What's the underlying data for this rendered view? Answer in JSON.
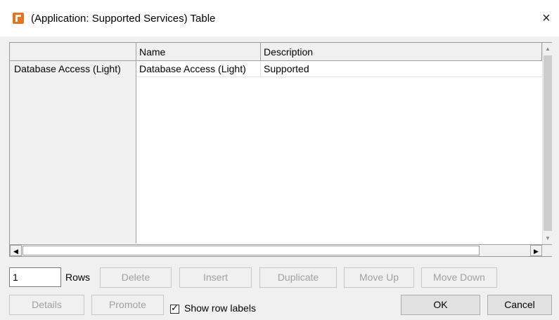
{
  "window": {
    "title": "(Application: Supported Services) Table",
    "close_symbol": "×"
  },
  "table": {
    "columns": [
      "Name",
      "Description"
    ],
    "rows": [
      {
        "label": "Database Access (Light)",
        "cells": [
          "Database Access (Light)",
          "Supported"
        ]
      }
    ]
  },
  "scrollbars": {
    "up_arrow": "▲",
    "down_arrow": "▼",
    "left_arrow": "◀",
    "right_arrow": "▶"
  },
  "rows_control": {
    "value": "1",
    "label": "Rows"
  },
  "buttons": {
    "delete": "Delete",
    "insert": "Insert",
    "duplicate": "Duplicate",
    "move_up": "Move Up",
    "move_down": "Move Down",
    "details": "Details",
    "promote": "Promote",
    "ok": "OK",
    "cancel": "Cancel"
  },
  "show_row_labels": {
    "label": "Show row labels",
    "checked": true
  }
}
